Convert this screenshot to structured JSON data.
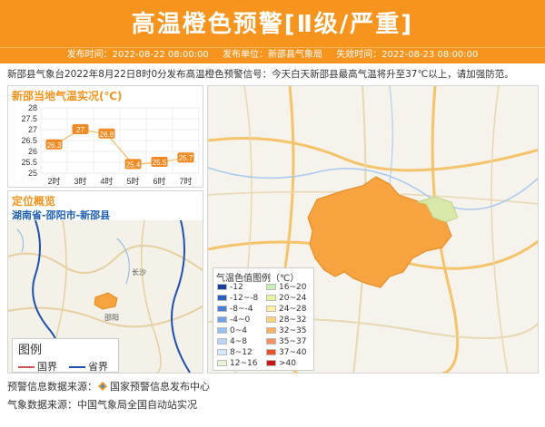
{
  "header": {
    "title": "高温橙色预警[Ⅱ级/严重]",
    "publish_time": "发布时间：2022-08-22 08:00:00",
    "publisher": "发布单位：新邵县气象局",
    "expire_time": "失效时间：2022-08-23 08:00:00",
    "color": "#f7941d"
  },
  "description": "新邵县气象台2022年8月22日8时0分发布高温橙色预警信号：今天白天新邵县最高气温将升至37℃以上，请加强防范。",
  "temp_panel": {
    "title": "新邵当地气温实况(℃)"
  },
  "chart_data": {
    "type": "line",
    "title": "新邵当地气温实况(℃)",
    "categories": [
      "2时",
      "3时",
      "4时",
      "5时",
      "6时",
      "7时"
    ],
    "values": [
      26.3,
      27,
      26.8,
      25.4,
      25.5,
      25.7
    ],
    "ylim": [
      25,
      28
    ],
    "yticks": [
      "28",
      "27.5",
      "27",
      "26.5",
      "26",
      "25.5",
      "25"
    ],
    "grid": true,
    "label_color": "#f08a24"
  },
  "location": {
    "title": "定位概览",
    "name": "湖南省-邵阳市-新邵县",
    "city_labels": [
      "长沙",
      "邵阳"
    ],
    "legend_title": "图例",
    "legend_items": [
      "国界",
      "省界"
    ]
  },
  "map": {
    "legend_title": "气温色值图例（℃）",
    "legend_items": [
      {
        "label": "-12",
        "color": "#1a3e9e"
      },
      {
        "label": "16~20",
        "color": "#c8f0b4"
      },
      {
        "label": "-12~-8",
        "color": "#2d5ec0"
      },
      {
        "label": "20~24",
        "color": "#e8f5a0"
      },
      {
        "label": "-8~-4",
        "color": "#4a7fd8"
      },
      {
        "label": "24~28",
        "color": "#fff0a0"
      },
      {
        "label": "-4~0",
        "color": "#6fa0e8"
      },
      {
        "label": "28~32",
        "color": "#ffd27a"
      },
      {
        "label": "0~4",
        "color": "#96bff2"
      },
      {
        "label": "32~35",
        "color": "#ffb060"
      },
      {
        "label": "4~8",
        "color": "#b9d6f7"
      },
      {
        "label": "35~37",
        "color": "#f79060"
      },
      {
        "label": "8~12",
        "color": "#d6e8fb"
      },
      {
        "label": "37~40",
        "color": "#e8502a"
      },
      {
        "label": "12~16",
        "color": "#e6f5d6"
      },
      {
        "label": ">40",
        "color": "#c81414"
      }
    ]
  },
  "footer": {
    "source1": "预警信息数据来源：",
    "source1_org": "国家预警信息发布中心",
    "source2": "气象数据来源：中国气象局全国自动站实况"
  }
}
